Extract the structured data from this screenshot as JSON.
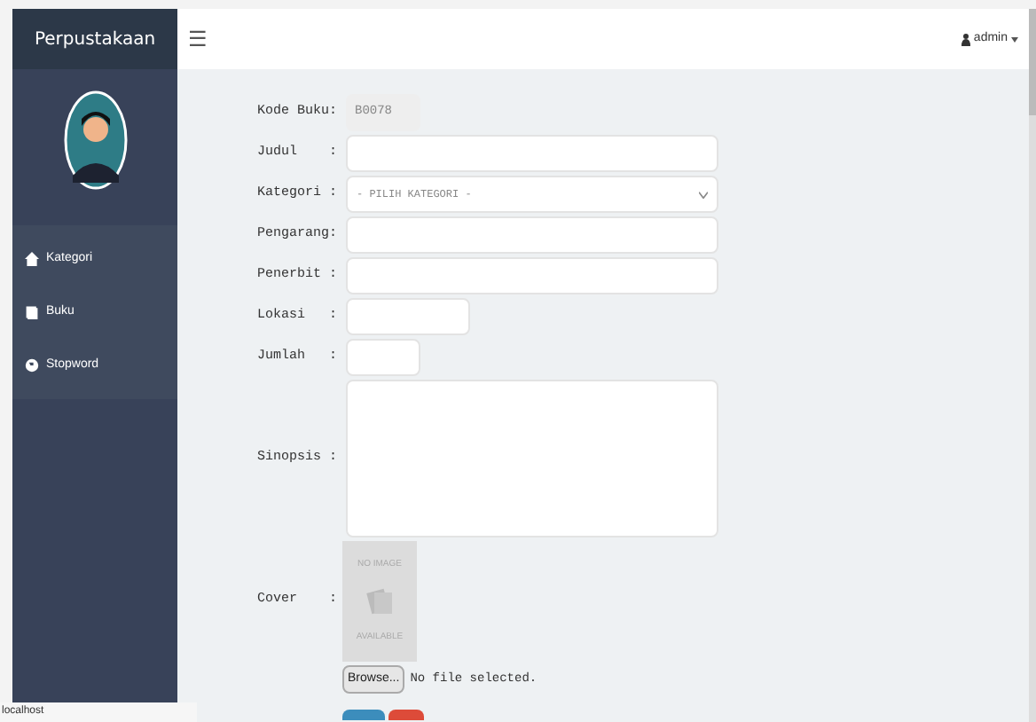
{
  "sidebar": {
    "brand": "Perpustakaan",
    "items": [
      {
        "label": "Kategori"
      },
      {
        "label": "Buku"
      },
      {
        "label": "Stopword"
      }
    ]
  },
  "topbar": {
    "menu_icon": "☰",
    "user": "admin"
  },
  "form": {
    "fields": [
      {
        "label": "Kode Buku:",
        "kind": "readonly",
        "value": "B0078"
      },
      {
        "label": "Judul    :",
        "kind": "text"
      },
      {
        "label": "Kategori :",
        "kind": "select",
        "value": "- PILIH KATEGORI -"
      },
      {
        "label": "Pengarang:",
        "kind": "text"
      },
      {
        "label": "Penerbit :",
        "kind": "text"
      },
      {
        "label": "Lokasi   :",
        "kind": "text"
      },
      {
        "label": "Jumlah   :",
        "kind": "text"
      },
      {
        "label": "Sinopsis :",
        "kind": "textarea"
      }
    ],
    "cover": {
      "label": "Cover    :",
      "image_top": "NO IMAGE",
      "image_bottom": "AVAILABLE",
      "browse": "Browse...",
      "file_status": "No file selected."
    }
  },
  "status_bar": "localhost"
}
